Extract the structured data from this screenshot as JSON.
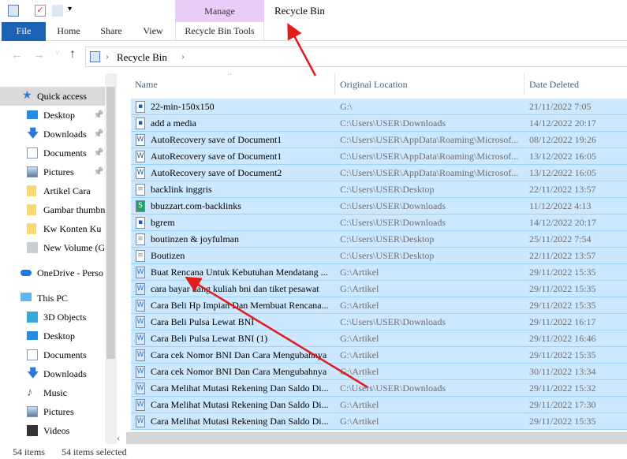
{
  "window": {
    "title": "Recycle Bin",
    "context_tab": "Manage",
    "qat_overflow": "▾"
  },
  "ribbon": {
    "tabs": [
      "File",
      "Home",
      "Share",
      "View",
      "Recycle Bin Tools"
    ]
  },
  "address": {
    "back": "←",
    "forward": "→",
    "recent": "˅",
    "up": "↑",
    "sep": "›",
    "path": "Recycle Bin"
  },
  "nav": {
    "quick_access": "Quick access",
    "quick_items": [
      {
        "label": "Desktop",
        "icon": "desktop-icon",
        "pinned": true
      },
      {
        "label": "Downloads",
        "icon": "downloads-icon",
        "pinned": true
      },
      {
        "label": "Documents",
        "icon": "documents-icon",
        "pinned": true
      },
      {
        "label": "Pictures",
        "icon": "pictures-icon",
        "pinned": true
      },
      {
        "label": "Artikel Cara",
        "icon": "folder-icon"
      },
      {
        "label": "Gambar thumbn",
        "icon": "folder-icon"
      },
      {
        "label": "Kw Konten Ku",
        "icon": "folder-icon"
      },
      {
        "label": "New Volume (G",
        "icon": "network-drive-icon"
      }
    ],
    "onedrive": "OneDrive - Perso",
    "this_pc": "This PC",
    "pc_items": [
      {
        "label": "3D Objects",
        "icon": "3d-objects-icon"
      },
      {
        "label": "Desktop",
        "icon": "desktop-icon"
      },
      {
        "label": "Documents",
        "icon": "documents-icon"
      },
      {
        "label": "Downloads",
        "icon": "downloads-icon"
      },
      {
        "label": "Music",
        "icon": "music-icon"
      },
      {
        "label": "Pictures",
        "icon": "pictures-icon"
      },
      {
        "label": "Videos",
        "icon": "videos-icon"
      }
    ]
  },
  "list": {
    "columns": [
      "Name",
      "Original Location",
      "Date Deleted"
    ],
    "sort_indicator": "^",
    "rows": [
      {
        "name": "22-min-150x150",
        "loc": "G:\\",
        "date": "21/11/2022 7:05",
        "type": "image"
      },
      {
        "name": "add a media",
        "loc": "C:\\Users\\USER\\Downloads",
        "date": "14/12/2022 20:17",
        "type": "image"
      },
      {
        "name": "AutoRecovery save of Document1",
        "loc": "C:\\Users\\USER\\AppData\\Roaming\\Microsof...",
        "date": "08/12/2022 19:26",
        "type": "word-recovery"
      },
      {
        "name": "AutoRecovery save of Document1",
        "loc": "C:\\Users\\USER\\AppData\\Roaming\\Microsof...",
        "date": "13/12/2022 16:05",
        "type": "word-recovery"
      },
      {
        "name": "AutoRecovery save of Document2",
        "loc": "C:\\Users\\USER\\AppData\\Roaming\\Microsof...",
        "date": "13/12/2022 16:05",
        "type": "word-recovery"
      },
      {
        "name": "backlink inggris",
        "loc": "C:\\Users\\USER\\Desktop",
        "date": "22/11/2022 13:57",
        "type": "text"
      },
      {
        "name": "bbuzzart.com-backlinks",
        "loc": "C:\\Users\\USER\\Downloads",
        "date": "11/12/2022 4:13",
        "type": "sheet"
      },
      {
        "name": "bgrem",
        "loc": "C:\\Users\\USER\\Downloads",
        "date": "14/12/2022 20:17",
        "type": "image"
      },
      {
        "name": "boutinzen & joyfulman",
        "loc": "C:\\Users\\USER\\Desktop",
        "date": "25/11/2022 7:54",
        "type": "text"
      },
      {
        "name": "Boutizen",
        "loc": "C:\\Users\\USER\\Desktop",
        "date": "22/11/2022 13:57",
        "type": "text"
      },
      {
        "name": "Buat Rencana Untuk Kebutuhan Mendatang ...",
        "loc": "G:\\Artikel",
        "date": "29/11/2022 15:35",
        "type": "word"
      },
      {
        "name": "cara bayar uang kuliah bni dan tiket pesawat",
        "loc": "G:\\Artikel",
        "date": "29/11/2022 15:35",
        "type": "word"
      },
      {
        "name": "Cara Beli Hp Impian Dan Membuat Rencana...",
        "loc": "G:\\Artikel",
        "date": "29/11/2022 15:35",
        "type": "word"
      },
      {
        "name": "Cara Beli Pulsa Lewat BNI",
        "loc": "C:\\Users\\USER\\Downloads",
        "date": "29/11/2022 16:17",
        "type": "word"
      },
      {
        "name": "Cara Beli Pulsa Lewat BNI (1)",
        "loc": "G:\\Artikel",
        "date": "29/11/2022 16:46",
        "type": "word"
      },
      {
        "name": "Cara cek Nomor BNI Dan Cara Mengubahnya",
        "loc": "G:\\Artikel",
        "date": "29/11/2022 15:35",
        "type": "word"
      },
      {
        "name": "Cara cek Nomor BNI Dan Cara Mengubahnya",
        "loc": "G:\\Artikel",
        "date": "30/11/2022 13:34",
        "type": "word"
      },
      {
        "name": "Cara Melihat Mutasi Rekening Dan Saldo Di...",
        "loc": "C:\\Users\\USER\\Downloads",
        "date": "29/11/2022 15:32",
        "type": "word"
      },
      {
        "name": "Cara Melihat Mutasi Rekening Dan Saldo Di...",
        "loc": "G:\\Artikel",
        "date": "29/11/2022 17:30",
        "type": "word"
      },
      {
        "name": "Cara Melihat Mutasi Rekening Dan Saldo Di...",
        "loc": "G:\\Artikel",
        "date": "29/11/2022 15:35",
        "type": "word"
      }
    ]
  },
  "status": {
    "count": "54 items",
    "selected": "54 items selected"
  },
  "colors": {
    "file_tab": "#1c63b7",
    "context_tab": "#e8cdf7",
    "selection": "#cce8ff",
    "annotation_arrow": "#e31b1b"
  }
}
